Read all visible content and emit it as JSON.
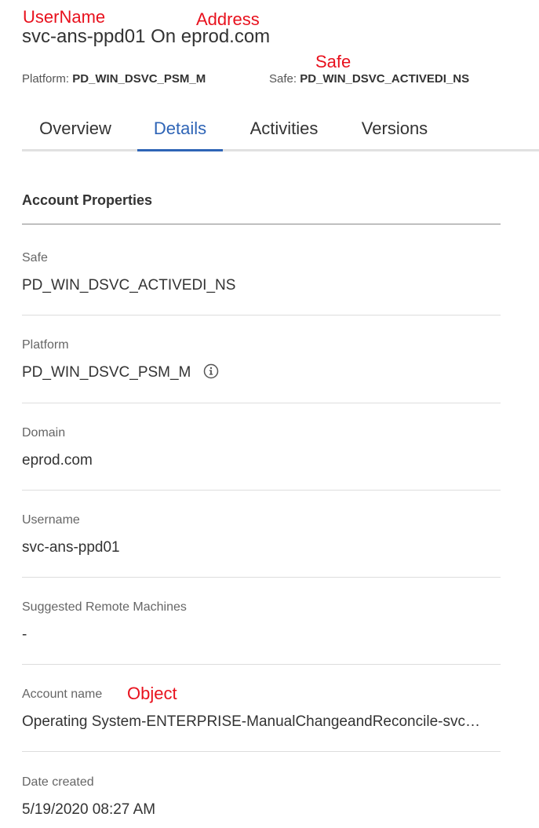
{
  "annotations": {
    "username": "UserName",
    "address": "Address",
    "safe": "Safe",
    "object": "Object"
  },
  "header": {
    "username": "svc-ans-ppd01",
    "on_word": "On",
    "address": "eprod.com",
    "platform_label": "Platform:",
    "platform_value": "PD_WIN_DSVC_PSM_M",
    "safe_label": "Safe:",
    "safe_value": "PD_WIN_DSVC_ACTIVEDI_NS"
  },
  "tabs": [
    {
      "label": "Overview",
      "active": false
    },
    {
      "label": "Details",
      "active": true
    },
    {
      "label": "Activities",
      "active": false
    },
    {
      "label": "Versions",
      "active": false
    }
  ],
  "section": {
    "title": "Account Properties"
  },
  "properties": [
    {
      "label": "Safe",
      "value": "PD_WIN_DSVC_ACTIVEDI_NS"
    },
    {
      "label": "Platform",
      "value": "PD_WIN_DSVC_PSM_M",
      "icon": "info-icon"
    },
    {
      "label": "Domain",
      "value": "eprod.com"
    },
    {
      "label": "Username",
      "value": "svc-ans-ppd01"
    },
    {
      "label": "Suggested Remote Machines",
      "value": "-"
    },
    {
      "label": "Account name",
      "value": "Operating System-ENTERPRISE-ManualChangeandReconcile-svc…"
    },
    {
      "label": "Date created",
      "value": "5/19/2020 08:27 AM"
    }
  ],
  "colors": {
    "annotation": "#e8111d",
    "tab_active": "#2e64b6",
    "text": "#333333"
  }
}
